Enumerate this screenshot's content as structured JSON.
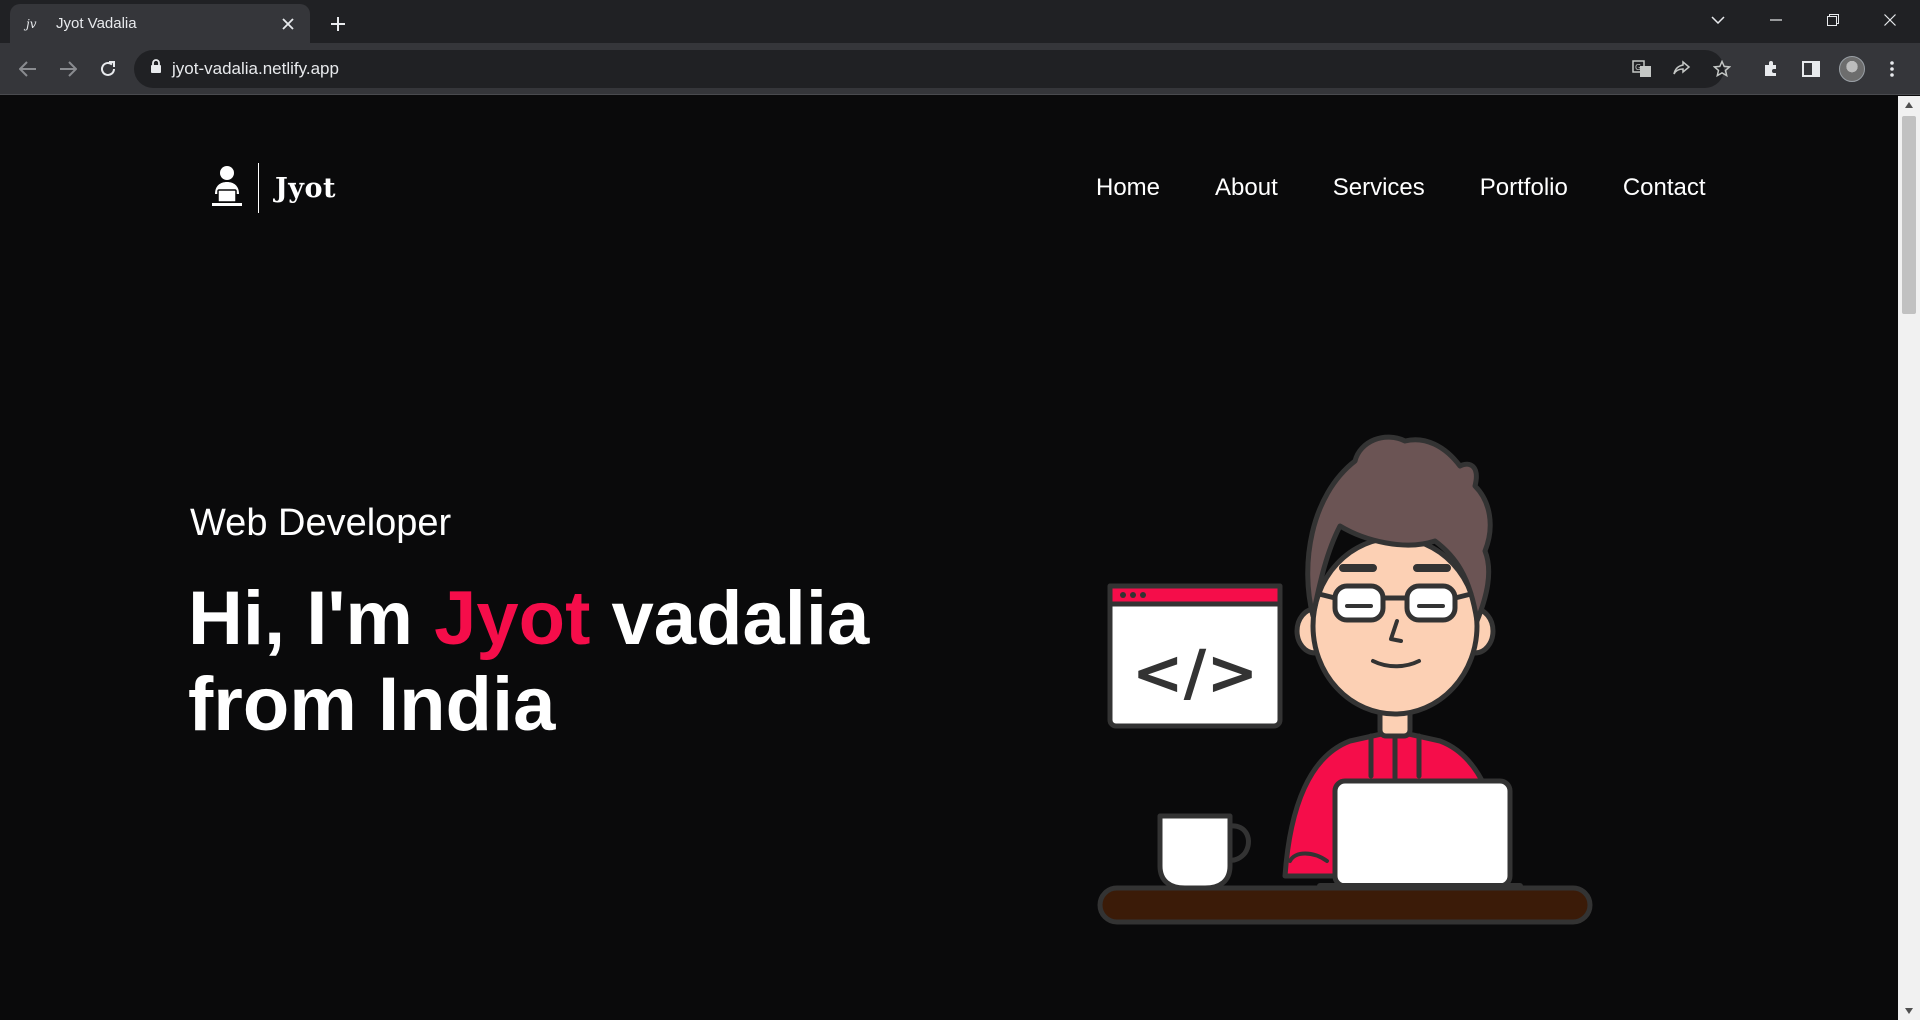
{
  "browser": {
    "tab": {
      "favicon": "jv",
      "title": "Jyot Vadalia"
    },
    "url": "jyot-vadalia.netlify.app"
  },
  "site": {
    "logo_text": "Jyot",
    "nav": [
      "Home",
      "About",
      "Services",
      "Portfolio",
      "Contact"
    ]
  },
  "hero": {
    "subtitle": "Web Developer",
    "line1_prefix": "Hi, I'm ",
    "line1_name": "Jyot",
    "line1_suffix": " vadalia",
    "line2": "from India",
    "code_symbol": "</>"
  },
  "colors": {
    "accent": "#f50d4a",
    "background": "#0a0a0b",
    "chrome_dark": "#202124",
    "chrome_light": "#35363a"
  },
  "icons": [
    "back-icon",
    "forward-icon",
    "reload-icon",
    "lock-icon",
    "translate-icon",
    "share-icon",
    "star-icon",
    "extensions-icon",
    "sidepanel-icon",
    "menu-icon"
  ]
}
